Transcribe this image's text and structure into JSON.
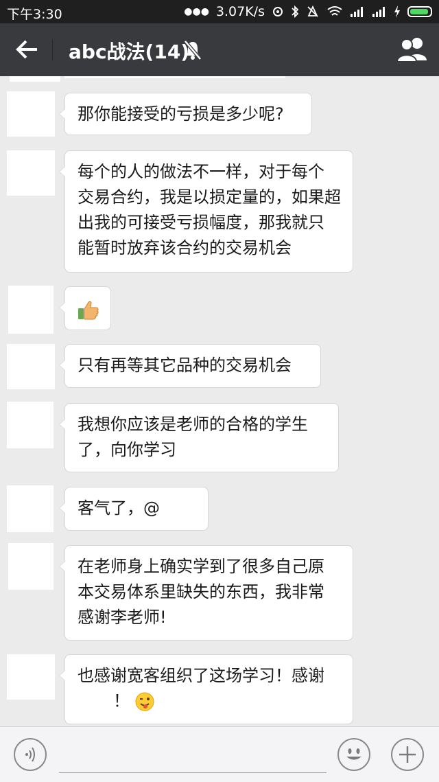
{
  "status_bar": {
    "time": "下午3:30",
    "speed": "3.07K/s"
  },
  "header": {
    "title": "abc战法(14)"
  },
  "messages": [
    {
      "lines": [
        "那你能接受的亏损是多少呢?"
      ]
    },
    {
      "lines": [
        "每个的人的做法不一样，对于每个",
        "交易合约，我是以损定量的，如果超",
        "出我的可接受亏损幅度，那我就只",
        "能暂时放弃该合约的交易机会"
      ]
    },
    {
      "emoji": "thumbs-up"
    },
    {
      "lines": [
        "只有再等其它品种的交易机会"
      ]
    },
    {
      "lines": [
        "我想你应该是老师的合格的学生",
        "了，向你学习"
      ]
    },
    {
      "lines": [
        "客气了，@"
      ]
    },
    {
      "lines": [
        "在老师身上确实学到了很多自己原",
        "本交易体系里缺失的东西，我非常",
        "感谢李老师!"
      ]
    },
    {
      "lines": [
        "也感谢宽客组织了这场学习！感谢",
        "！"
      ],
      "trailing_emoji": "winking-face-tongue"
    }
  ],
  "colors": {
    "status_bg": "#1f1f1f",
    "header_bg": "#393a3e",
    "chat_bg": "#ebebeb",
    "bubble_bg": "#ffffff",
    "battery_green": "#4cd964"
  },
  "icons": [
    "back-arrow-icon",
    "mute-bell-icon",
    "group-members-icon",
    "voice-icon",
    "emoji-icon",
    "plus-icon"
  ]
}
